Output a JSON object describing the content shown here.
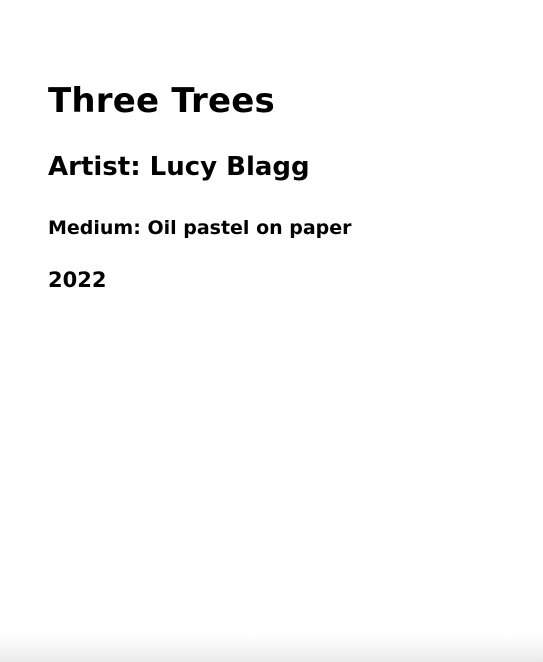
{
  "artwork": {
    "title": "Three Trees",
    "artist": "Artist: Lucy Blagg",
    "medium": "Medium: Oil pastel on paper",
    "year": "2022"
  }
}
